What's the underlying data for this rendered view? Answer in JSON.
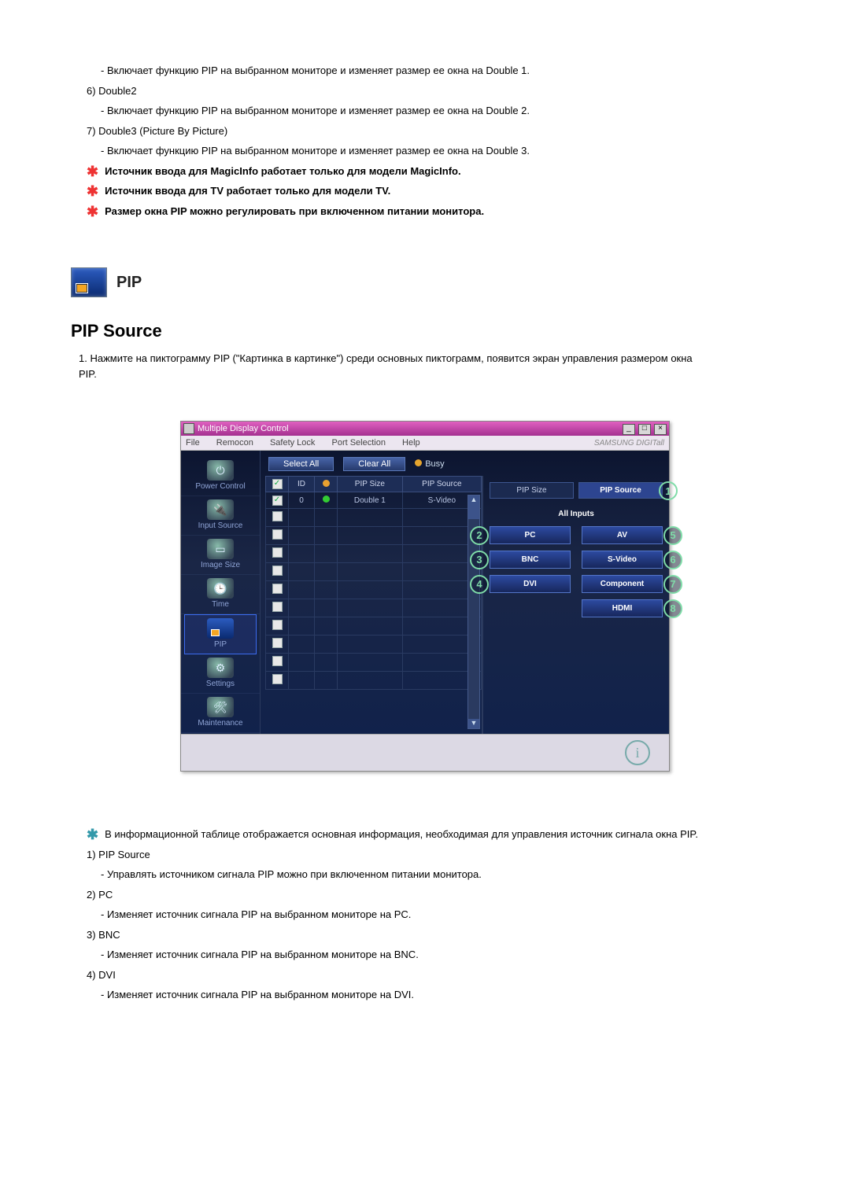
{
  "intro": {
    "double1_desc": "- Включает функцию PIP на выбранном мониторе и изменяет размер ее окна на Double 1.",
    "item6_label": "6)  Double2",
    "double2_desc": "- Включает функцию PIP на выбранном мониторе и изменяет размер ее окна на Double 2.",
    "item7_label": "7)  Double3 (Picture By Picture)",
    "double3_desc": "- Включает функцию PIP на выбранном мониторе и изменяет размер ее окна на Double 3.",
    "note1": "Источник ввода для MagicInfo работает только для модели MagicInfo.",
    "note2": "Источник ввода для TV работает только для модели TV.",
    "note3": "Размер окна PIP можно регулировать при включенном питании монитора."
  },
  "pip_header": "PIP",
  "section_title": "PIP Source",
  "step1": "1. Нажмите на пиктограмму PIP (\"Картинка в картинке\") среди основных пиктограмм, появится экран управления размером окна PIP.",
  "app": {
    "title": "Multiple Display Control",
    "menus": [
      "File",
      "Remocon",
      "Safety Lock",
      "Port Selection",
      "Help"
    ],
    "brand": "SAMSUNG DIGITall",
    "buttons": {
      "select_all": "Select All",
      "clear_all": "Clear All",
      "busy": "Busy"
    },
    "sidebar": [
      "Power Control",
      "Input Source",
      "Image Size",
      "Time",
      "PIP",
      "Settings",
      "Maintenance"
    ],
    "table": {
      "headers": [
        "",
        "ID",
        "",
        "PIP Size",
        "PIP Source"
      ],
      "rows": [
        {
          "checked": true,
          "id": "0",
          "status": "green",
          "size": "Double 1",
          "source": "S-Video"
        },
        {
          "checked": false,
          "id": "",
          "status": "",
          "size": "",
          "source": ""
        },
        {
          "checked": false,
          "id": "",
          "status": "",
          "size": "",
          "source": ""
        },
        {
          "checked": false,
          "id": "",
          "status": "",
          "size": "",
          "source": ""
        },
        {
          "checked": false,
          "id": "",
          "status": "",
          "size": "",
          "source": ""
        },
        {
          "checked": false,
          "id": "",
          "status": "",
          "size": "",
          "source": ""
        },
        {
          "checked": false,
          "id": "",
          "status": "",
          "size": "",
          "source": ""
        },
        {
          "checked": false,
          "id": "",
          "status": "",
          "size": "",
          "source": ""
        },
        {
          "checked": false,
          "id": "",
          "status": "",
          "size": "",
          "source": ""
        },
        {
          "checked": false,
          "id": "",
          "status": "",
          "size": "",
          "source": ""
        },
        {
          "checked": false,
          "id": "",
          "status": "",
          "size": "",
          "source": ""
        }
      ]
    },
    "right": {
      "tabs": {
        "size": "PIP Size",
        "source": "PIP Source"
      },
      "title": "All Inputs",
      "sources": {
        "pc": "PC",
        "av": "AV",
        "bnc": "BNC",
        "svideo": "S-Video",
        "dvi": "DVI",
        "component": "Component",
        "hdmi": "HDMI"
      },
      "callouts": {
        "c1": "1",
        "c2": "2",
        "c3": "3",
        "c4": "4",
        "c5": "5",
        "c6": "6",
        "c7": "7",
        "c8": "8"
      }
    }
  },
  "after": {
    "info_note": "В информационной таблице отображается основная информация, необходимая для управления источник сигнала окна PIP.",
    "items": [
      {
        "label": "1)  PIP Source",
        "desc": "- Управлять источником сигнала PIP можно при включенном питании монитора."
      },
      {
        "label": "2)  PC",
        "desc": "- Изменяет источник сигнала PIP на выбранном мониторе на PC."
      },
      {
        "label": "3)  BNC",
        "desc": "- Изменяет источник сигнала PIP на выбранном мониторе на BNC."
      },
      {
        "label": "4)  DVI",
        "desc": "- Изменяет источник сигнала PIP на выбранном мониторе на DVI."
      }
    ]
  }
}
